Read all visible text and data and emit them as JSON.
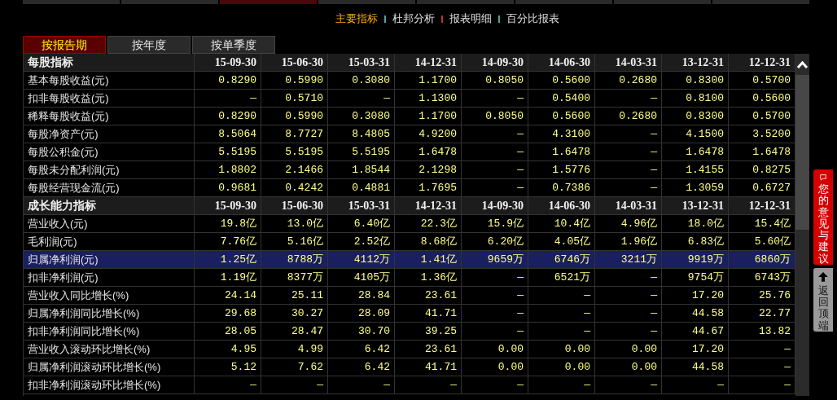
{
  "top_tabs": [
    {
      "selected": false
    },
    {
      "selected": false
    },
    {
      "selected": true
    },
    {
      "selected": false
    },
    {
      "selected": false
    },
    {
      "selected": false
    },
    {
      "selected": false
    },
    {
      "selected": false
    }
  ],
  "nav_links": [
    {
      "label": "主要指标",
      "selected": true
    },
    {
      "label": "杜邦分析",
      "selected": false
    },
    {
      "label": "报表明细",
      "selected": false
    },
    {
      "label": "百分比报表",
      "selected": false
    }
  ],
  "period_tabs": [
    {
      "label": "按报告期",
      "selected": true
    },
    {
      "label": "按年度",
      "selected": false
    },
    {
      "label": "按单季度",
      "selected": false
    }
  ],
  "sections": [
    {
      "title": "每股指标",
      "dates": [
        "15-09-30",
        "15-06-30",
        "15-03-31",
        "14-12-31",
        "14-09-30",
        "14-06-30",
        "14-03-31",
        "13-12-31",
        "12-12-31"
      ],
      "rows": [
        {
          "label": "基本每股收益(元)",
          "selected": false,
          "values": [
            "0.8290",
            "0.5990",
            "0.3080",
            "1.1700",
            "0.8050",
            "0.5600",
            "0.2680",
            "0.8300",
            "0.5700"
          ]
        },
        {
          "label": "扣非每股收益(元)",
          "selected": false,
          "values": [
            "—",
            "0.5710",
            "—",
            "1.1300",
            "—",
            "0.5400",
            "—",
            "0.8100",
            "0.5600"
          ]
        },
        {
          "label": "稀释每股收益(元)",
          "selected": false,
          "values": [
            "0.8290",
            "0.5990",
            "0.3080",
            "1.1700",
            "0.8050",
            "0.5600",
            "0.2680",
            "0.8300",
            "0.5700"
          ]
        },
        {
          "label": "每股净资产(元)",
          "selected": false,
          "values": [
            "8.5064",
            "8.7727",
            "8.4805",
            "4.9200",
            "—",
            "4.3100",
            "—",
            "4.1500",
            "3.5200"
          ]
        },
        {
          "label": "每股公积金(元)",
          "selected": false,
          "values": [
            "5.5195",
            "5.5195",
            "5.5195",
            "1.6478",
            "—",
            "1.6478",
            "—",
            "1.6478",
            "1.6478"
          ]
        },
        {
          "label": "每股未分配利润(元)",
          "selected": false,
          "values": [
            "1.8802",
            "2.1466",
            "1.8544",
            "2.1298",
            "—",
            "1.5776",
            "—",
            "1.4155",
            "0.8275"
          ]
        },
        {
          "label": "每股经营现金流(元)",
          "selected": false,
          "values": [
            "0.9681",
            "0.4242",
            "0.4881",
            "1.7695",
            "—",
            "0.7386",
            "—",
            "1.3059",
            "0.6727"
          ]
        }
      ]
    },
    {
      "title": "成长能力指标",
      "dates": [
        "15-09-30",
        "15-06-30",
        "15-03-31",
        "14-12-31",
        "14-09-30",
        "14-06-30",
        "14-03-31",
        "13-12-31",
        "12-12-31"
      ],
      "rows": [
        {
          "label": "营业收入(元)",
          "selected": false,
          "values": [
            "19.8亿",
            "13.0亿",
            "6.40亿",
            "22.3亿",
            "15.9亿",
            "10.4亿",
            "4.96亿",
            "18.0亿",
            "15.4亿"
          ]
        },
        {
          "label": "毛利润(元)",
          "selected": false,
          "values": [
            "7.76亿",
            "5.16亿",
            "2.52亿",
            "8.68亿",
            "6.20亿",
            "4.05亿",
            "1.96亿",
            "6.83亿",
            "5.60亿"
          ]
        },
        {
          "label": "归属净利润(元)",
          "selected": true,
          "values": [
            "1.25亿",
            "8788万",
            "4112万",
            "1.41亿",
            "9659万",
            "6746万",
            "3211万",
            "9919万",
            "6860万"
          ]
        },
        {
          "label": "扣非净利润(元)",
          "selected": false,
          "values": [
            "1.19亿",
            "8377万",
            "4105万",
            "1.36亿",
            "—",
            "6521万",
            "—",
            "9754万",
            "6743万"
          ]
        },
        {
          "label": "营业收入同比增长(%)",
          "selected": false,
          "values": [
            "24.14",
            "25.11",
            "28.84",
            "23.61",
            "—",
            "—",
            "—",
            "17.20",
            "25.76"
          ]
        },
        {
          "label": "归属净利润同比增长(%)",
          "selected": false,
          "values": [
            "29.68",
            "30.27",
            "28.09",
            "41.71",
            "—",
            "—",
            "—",
            "44.58",
            "22.77"
          ]
        },
        {
          "label": "扣非净利润同比增长(%)",
          "selected": false,
          "values": [
            "28.05",
            "28.47",
            "30.70",
            "39.25",
            "—",
            "—",
            "—",
            "44.67",
            "13.82"
          ]
        },
        {
          "label": "营业收入滚动环比增长(%)",
          "selected": false,
          "values": [
            "4.95",
            "4.99",
            "6.42",
            "23.61",
            "0.00",
            "0.00",
            "0.00",
            "17.20",
            "—"
          ]
        },
        {
          "label": "归属净利润滚动环比增长(%)",
          "selected": false,
          "values": [
            "5.12",
            "7.62",
            "6.42",
            "41.71",
            "0.00",
            "0.00",
            "0.00",
            "44.58",
            "—"
          ]
        },
        {
          "label": "扣非净利润滚动环比增长(%)",
          "selected": false,
          "values": [
            "—",
            "—",
            "—",
            "—",
            "—",
            "—",
            "—",
            "—",
            "—"
          ]
        }
      ]
    }
  ],
  "side_buttons": [
    {
      "kind": "feedback",
      "label": "您的意见与建议"
    },
    {
      "kind": "top",
      "label": "返回顶端"
    }
  ]
}
